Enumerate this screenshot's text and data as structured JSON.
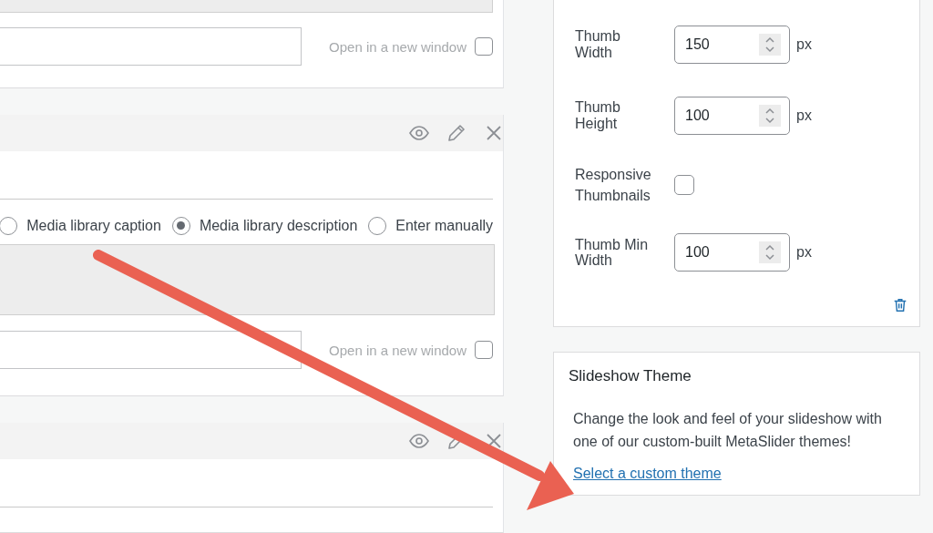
{
  "slides": [
    {
      "kind": "tail",
      "new_window": {
        "label": "Open in a new window",
        "checked": false
      }
    },
    {
      "kind": "full",
      "caption_options": [
        {
          "label": "Media library caption",
          "selected": false
        },
        {
          "label": "Media library description",
          "selected": true
        },
        {
          "label": "Enter manually",
          "selected": false
        }
      ],
      "new_window": {
        "label": "Open in a new window",
        "checked": false
      }
    },
    {
      "kind": "head"
    }
  ],
  "settings": [
    {
      "kind": "number",
      "label": "Thumb Width",
      "value": "150",
      "unit": "px"
    },
    {
      "kind": "number",
      "label": "Thumb Height",
      "value": "100",
      "unit": "px"
    },
    {
      "kind": "checkbox",
      "label": "Responsive Thumbnails",
      "checked": false
    },
    {
      "kind": "number",
      "label": "Thumb Min Width",
      "value": "100",
      "unit": "px"
    }
  ],
  "theme_card": {
    "title": "Slideshow Theme",
    "text": "Change the look and feel of your slideshow with one of our custom-built MetaSlider themes!",
    "link": "Select a custom theme"
  }
}
